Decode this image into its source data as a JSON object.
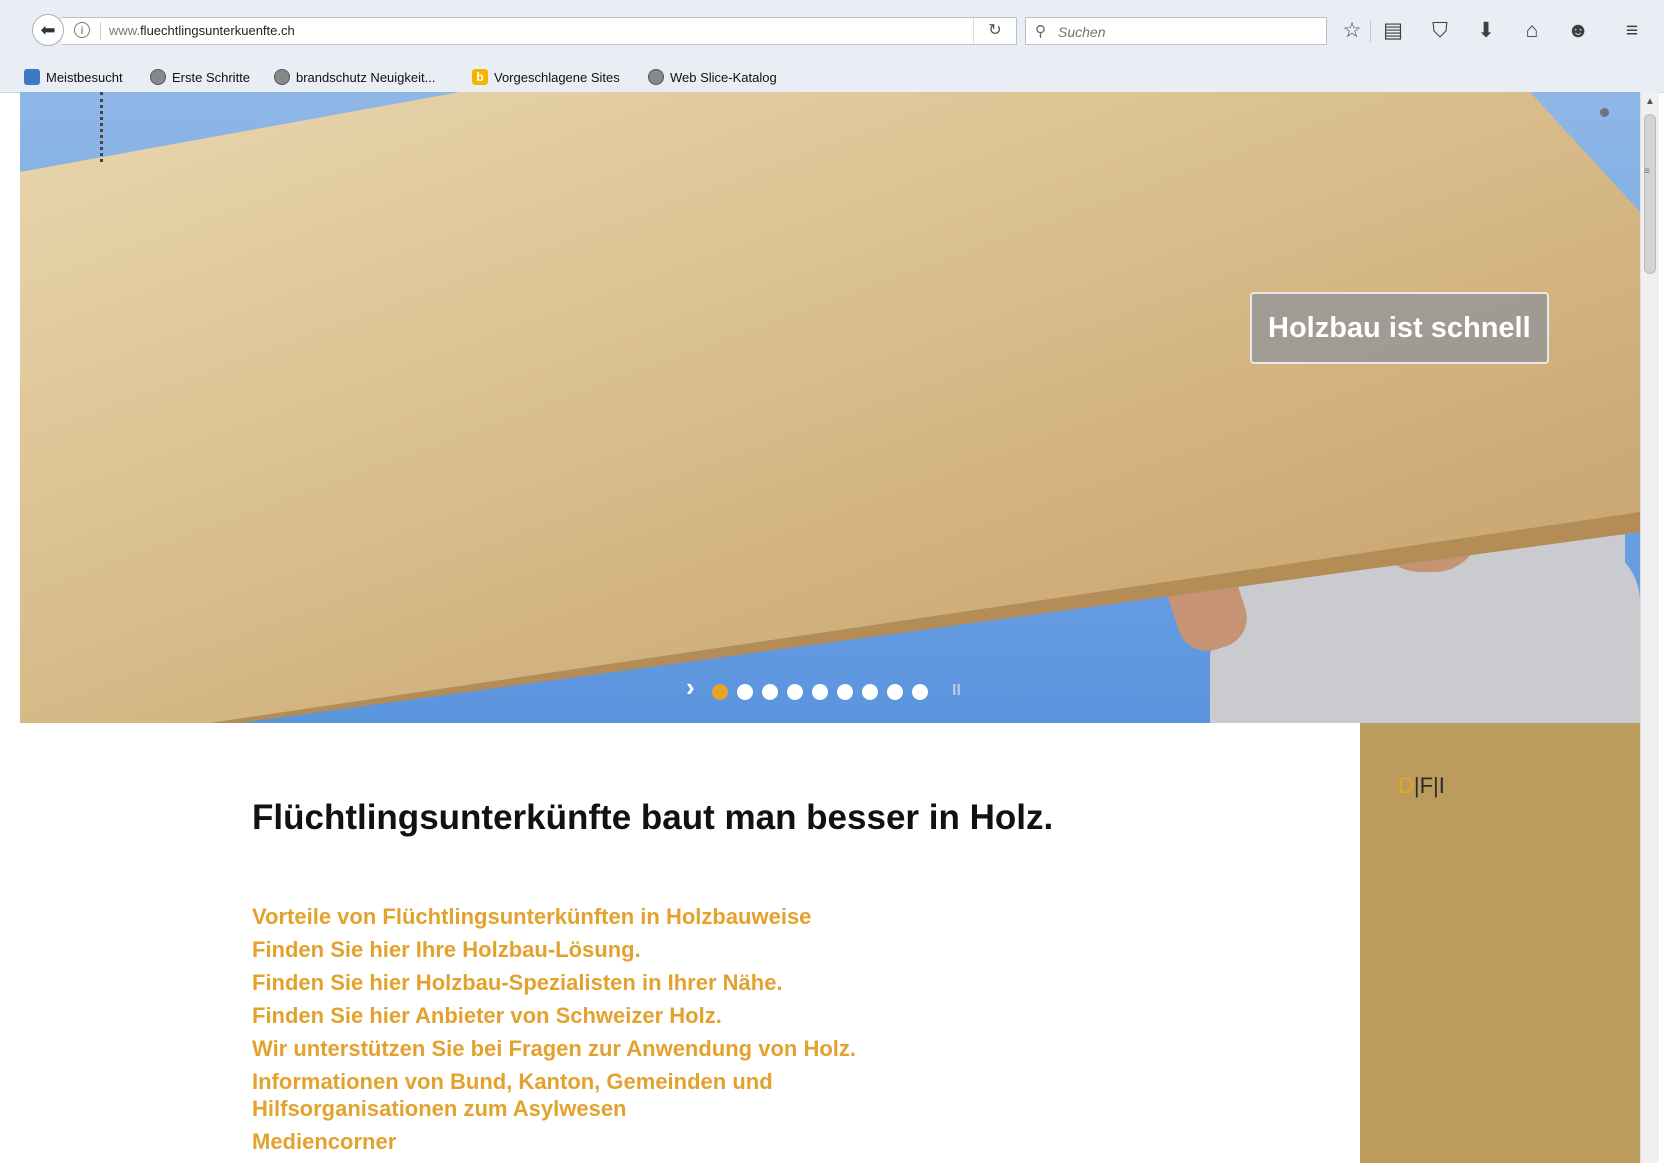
{
  "browser": {
    "url_host": "www.",
    "url_domain": "fluechtlingsunterkuenfte.ch",
    "search_placeholder": "Suchen",
    "bookmarks": [
      {
        "label": "Meistbesucht",
        "icon": "blue-square-icon"
      },
      {
        "label": "Erste Schritte",
        "icon": "globe-icon"
      },
      {
        "label": "brandschutz Neuigkeit...",
        "icon": "globe-icon"
      },
      {
        "label": "Vorgeschlagene Sites",
        "icon": "bing-icon"
      },
      {
        "label": "Web Slice-Katalog",
        "icon": "globe-icon"
      }
    ]
  },
  "hero": {
    "caption": "Holzbau ist schnell",
    "next_glyph": "›",
    "slide_count": 9,
    "active_slide": 1,
    "pause_glyph": "II"
  },
  "sidebar": {
    "lang_d": "D",
    "lang_rest": "|F|I"
  },
  "main": {
    "title": "Flüchtlingsunterkünfte baut man besser in Holz.",
    "links": [
      "Vorteile von Flüchtlingsunterkünften in Holzbauweise",
      "Finden Sie hier Ihre Holzbau-Lösung.",
      "Finden Sie hier Holzbau-Spezialisten in Ihrer Nähe.",
      "Finden Sie hier Anbieter von Schweizer Holz.",
      "Wir unterstützen Sie bei Fragen zur Anwendung von Holz.",
      "Informationen von Bund, Kanton, Gemeinden und Hilfsorganisationen zum Asylwesen",
      "Mediencorner"
    ]
  },
  "colors": {
    "accent": "#e2a22d",
    "sidebar": "#bb9c5c",
    "sky": "#6fa2e3"
  }
}
